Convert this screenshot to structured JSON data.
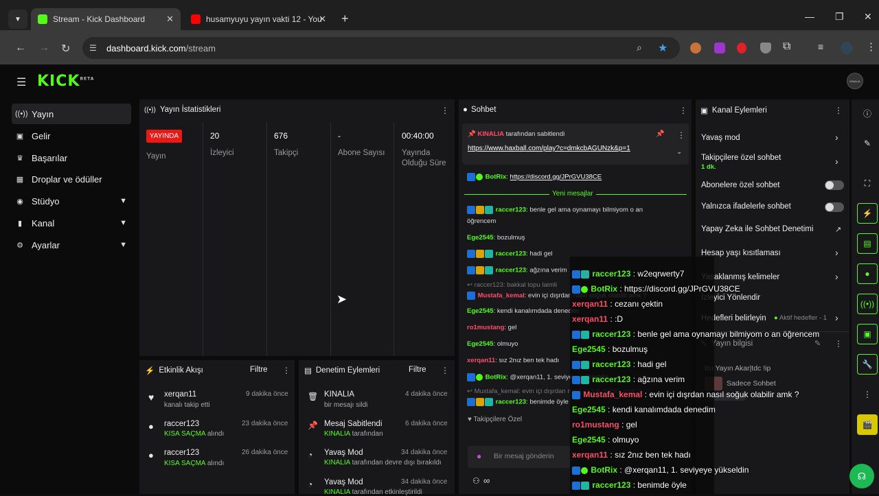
{
  "browser": {
    "tabs": [
      {
        "label": "Stream - Kick Dashboard",
        "icon": "kick-icon"
      },
      {
        "label": "husamyuyu yayın vakti 12 - You",
        "icon": "youtube-icon"
      }
    ],
    "url_domain": "dashboard.kick.com",
    "url_path": "/stream"
  },
  "brand": {
    "logo": "KICK",
    "beta": "BETA",
    "avatar_text": "KINALIA"
  },
  "sidebar": {
    "items": [
      {
        "label": "Yayın",
        "icon": "broadcast-icon"
      },
      {
        "label": "Gelir",
        "icon": "wallet-icon"
      },
      {
        "label": "Başarılar",
        "icon": "trophy-icon"
      },
      {
        "label": "Droplar ve ödüller",
        "icon": "gift-icon"
      },
      {
        "label": "Stüdyo",
        "icon": "studio-icon"
      },
      {
        "label": "Kanal",
        "icon": "channel-icon"
      },
      {
        "label": "Ayarlar",
        "icon": "gear-icon"
      }
    ]
  },
  "stats": {
    "title": "Yayın İstatistikleri",
    "live_badge": "YAYINDA",
    "live_label": "Yayın",
    "viewers_value": "20",
    "viewers_label": "İzleyici",
    "followers_value": "676",
    "followers_label": "Takipçi",
    "subs_value": "-",
    "subs_label": "Abone Sayısı",
    "duration_value": "00:40:00",
    "duration_label": "Yayında Olduğu Süre"
  },
  "activity": {
    "title": "Etkinlik Akışı",
    "filter": "Filtre",
    "items": [
      {
        "user": "xerqan11",
        "sub": "kanalı takip etti",
        "time": "9 dakika önce",
        "green": ""
      },
      {
        "user": "raccer123",
        "sub": "alındı",
        "green": "KISA SAÇMA",
        "time": "23 dakika önce"
      },
      {
        "user": "raccer123",
        "sub": "alındı",
        "green": "KISA SAÇMA",
        "time": "26 dakika önce"
      }
    ]
  },
  "moderation": {
    "title": "Denetim Eylemleri",
    "filter": "Filtre",
    "items": [
      {
        "title": "KINALIA",
        "sub": "bir mesajı sildi",
        "green": "",
        "time": "4 dakika önce"
      },
      {
        "title": "Mesaj Sabitlendi",
        "green": "KINALIA",
        "sub": "tarafından",
        "time": "6 dakika önce"
      },
      {
        "title": "Yavaş Mod",
        "green": "KINALIA",
        "sub": "tarafından devre dışı bırakıldı",
        "time": "34 dakika önce"
      },
      {
        "title": "Yavaş Mod",
        "green": "KINALIA",
        "sub": "tarafından etkinleştirildi",
        "time": "34 dakika önce"
      }
    ]
  },
  "chat": {
    "title": "Sohbet",
    "pinned_by": "KINALIA",
    "pinned_text": "tarafından sabitlendi",
    "pinned_link": "https://www.haxball.com/play?c=dmkcbAGUNzk&p=1",
    "new_messages": "Yeni mesajlar",
    "lines": [
      {
        "user": "BotRix",
        "text": "https://discord.gg/JPrGVU38CE"
      },
      {
        "user": "raccer123",
        "text": "benle gel ama oynamayı bilmiyom o an"
      },
      {
        "user": "",
        "text": "öğrencem"
      },
      {
        "user": "Ege2545",
        "text": "bozulmuş"
      },
      {
        "user": "raccer123",
        "text": "hadi gel"
      },
      {
        "user": "raccer123",
        "text": "ağzına verim"
      },
      {
        "user": "raccer123",
        "text": "bakkal topu laimli"
      },
      {
        "user": "Mustafa_kemal",
        "text": "evin içi dışrdan nasıl soğuk olabilir amk ?"
      },
      {
        "user": "Ege2545",
        "text": "kendi kanalımdada denedim"
      },
      {
        "user": "ro1mustang",
        "text": "gel"
      },
      {
        "user": "Ege2545",
        "text": "olmuyo"
      },
      {
        "user": "xerqan11",
        "text": "sız 2nız ben tek hadı"
      },
      {
        "user": "BotRix",
        "text": "@xerqan11, 1. seviyeye yükseldin"
      },
      {
        "user": "Mustafa_kemal",
        "text": "evin içi dışrdan nasıl soğuk olabilir amk ?"
      },
      {
        "user": "raccer123",
        "text": "benimde öyle"
      }
    ],
    "followers_only": "Takipçilere Özel",
    "input_placeholder": "Bir mesaj gönderin"
  },
  "overlay": {
    "lines": [
      {
        "user": "raccer123",
        "text": "w2eqrwerty7"
      },
      {
        "user": "BotRix",
        "text": "https://discord.gg/JPrGVU38CE"
      },
      {
        "user": "xerqan11",
        "text": "cezanı çektin"
      },
      {
        "user": "xerqan11",
        "text": ":D"
      },
      {
        "user": "raccer123",
        "text": "benle gel ama oynamayı bilmiyom o an öğrencem"
      },
      {
        "user": "Ege2545",
        "text": "bozulmuş"
      },
      {
        "user": "raccer123",
        "text": "hadi gel"
      },
      {
        "user": "raccer123",
        "text": "ağzına verim"
      },
      {
        "user": "Mustafa_kemal",
        "text": "evin içi dışrdan nasıl soğuk olabilir amk ?"
      },
      {
        "user": "Ege2545",
        "text": "kendi kanalımdada denedim"
      },
      {
        "user": "ro1mustang",
        "text": "gel"
      },
      {
        "user": "Ege2545",
        "text": "olmuyo"
      },
      {
        "user": "xerqan11",
        "text": "sız 2nız ben tek hadı"
      },
      {
        "user": "BotRix",
        "text": "@xerqan11, 1. seviyeye yükseldin"
      },
      {
        "user": "raccer123",
        "text": "benimde öyle"
      }
    ]
  },
  "channel_actions": {
    "title": "Kanal Eylemleri",
    "slow_mode": "Yavaş mod",
    "followers_chat": "Takipçilere özel sohbet",
    "followers_chat_value": "1 dk.",
    "subs_chat": "Abonelere özel sohbet",
    "emote_chat": "Yalnızca ifadelerle sohbet",
    "ai_moderation": "Yapay Zeka ile Sohbet Denetimi",
    "age_restriction": "Hesap yaşı kısıtlaması",
    "banned_words": "Yasaklanmış kelimeler",
    "viewer_redirect": "İzleyici Yönlendir",
    "set_goals": "Hedefleri belirleyin",
    "goals_status": "Aktif hedefler - 1",
    "stream_info": "Yayın bilgisi",
    "stream_title": "Bu Yayın Akar|tdc !ip",
    "chat_mode": "Sadece Sohbet"
  }
}
